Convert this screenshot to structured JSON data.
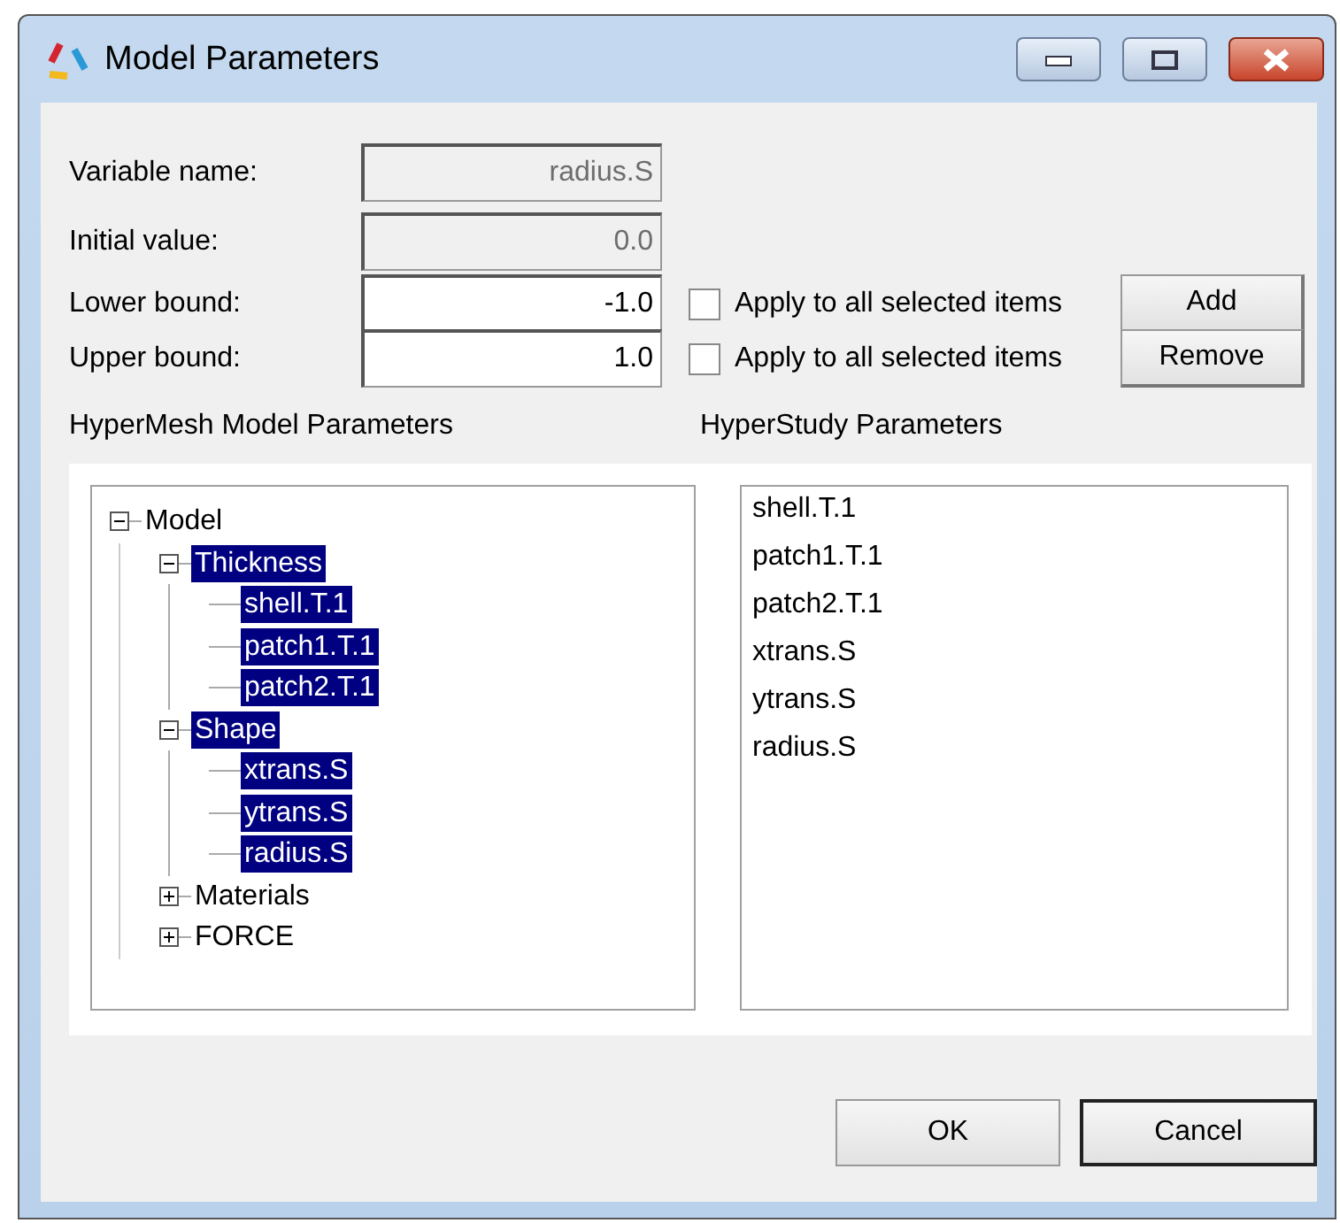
{
  "window": {
    "title": "Model Parameters"
  },
  "fields": [
    {
      "label": "Variable name:",
      "value": "radius.S",
      "disabled": true
    },
    {
      "label": "Initial value:",
      "value": "0.0",
      "disabled": true
    },
    {
      "label": "Lower bound:",
      "value": "-1.0",
      "disabled": false,
      "checkbox": {
        "label": "Apply to all selected items",
        "checked": false
      },
      "button": "Add"
    },
    {
      "label": "Upper bound:",
      "value": "1.0",
      "disabled": false,
      "checkbox": {
        "label": "Apply to all selected items",
        "checked": false
      },
      "button": "Remove"
    }
  ],
  "model_tree": {
    "title": "HyperMesh Model Parameters",
    "items": [
      {
        "label": "Model",
        "expanded": true,
        "selected": false,
        "children": [
          {
            "label": "Thickness",
            "expanded": true,
            "selected": true,
            "children": [
              {
                "label": "shell.T.1",
                "selected": true
              },
              {
                "label": "patch1.T.1",
                "selected": true
              },
              {
                "label": "patch2.T.1",
                "selected": true
              }
            ]
          },
          {
            "label": "Shape",
            "expanded": true,
            "selected": true,
            "children": [
              {
                "label": "xtrans.S",
                "selected": true
              },
              {
                "label": "ytrans.S",
                "selected": true
              },
              {
                "label": "radius.S",
                "selected": true
              }
            ]
          },
          {
            "label": "Materials",
            "expanded": false,
            "selected": false
          },
          {
            "label": "FORCE",
            "expanded": false,
            "selected": false
          }
        ]
      }
    ]
  },
  "study_list": {
    "title": "HyperStudy Parameters",
    "items": [
      "shell.T.1",
      "patch1.T.1",
      "patch2.T.1",
      "xtrans.S",
      "ytrans.S",
      "radius.S"
    ]
  },
  "buttons": [
    {
      "label": "OK",
      "default": false
    },
    {
      "label": "Cancel",
      "default": true
    }
  ]
}
